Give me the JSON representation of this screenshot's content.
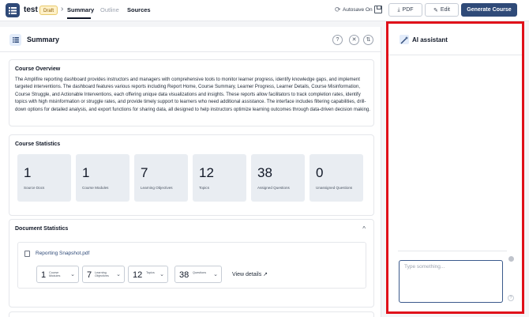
{
  "header": {
    "doc_title": "test",
    "draft_badge": "Draft",
    "breadcrumb_chevron": "›",
    "tabs": [
      "Summary",
      "Outline",
      "Sources"
    ],
    "autosave_label": "Autosave On",
    "pdf_label": "PDF",
    "edit_label": "Edit",
    "generate_label": "Generate Course"
  },
  "summary": {
    "title": "Summary",
    "help_icon": "?",
    "close_icon": "✕",
    "sort_icon": "⇅"
  },
  "overview": {
    "heading": "Course Overview",
    "text": "The Amplifire reporting dashboard provides instructors and managers with comprehensive tools to monitor learner progress, identify knowledge gaps, and implement targeted interventions. The dashboard features various reports including Report Home, Course Summary, Learner Progress, Learner Details, Course Misinformation, Course Struggle, and Actionable Interventions, each offering unique data visualizations and insights. These reports allow facilitators to track completion rates, identify topics with high misinformation or struggle rates, and provide timely support to learners who need additional assistance. The interface includes filtering capabilities, drill-down options for detailed analysis, and export functions for sharing data, all designed to help instructors optimize learning outcomes through data-driven decision making."
  },
  "course_stats": {
    "heading": "Course Statistics",
    "items": [
      {
        "value": "1",
        "label": "Source Docs"
      },
      {
        "value": "1",
        "label": "Course Modules"
      },
      {
        "value": "7",
        "label": "Learning Objectives"
      },
      {
        "value": "12",
        "label": "Topics"
      },
      {
        "value": "38",
        "label": "Assigned Questions"
      },
      {
        "value": "0",
        "label": "Unassigned Questions"
      }
    ]
  },
  "doc_stats": {
    "heading": "Document Statistics",
    "collapse_icon": "^",
    "file_name": "Reporting Snapshot.pdf",
    "chips": [
      {
        "value": "1",
        "label": "Course Modules"
      },
      {
        "value": "7",
        "label": "Learning Objectives"
      },
      {
        "value": "12",
        "label": "Topics"
      },
      {
        "value": "38",
        "label": "Questions"
      }
    ],
    "chip_chevron": "⌄",
    "view_details": "View details ↗"
  },
  "ai_assistant": {
    "title": "AI assistant",
    "input_placeholder": "Type something...",
    "input_value": "",
    "help_icon": "?"
  },
  "colors": {
    "brand": "#2f4a78",
    "highlight_border": "#e0101a",
    "stat_box": "#e9edf2"
  }
}
